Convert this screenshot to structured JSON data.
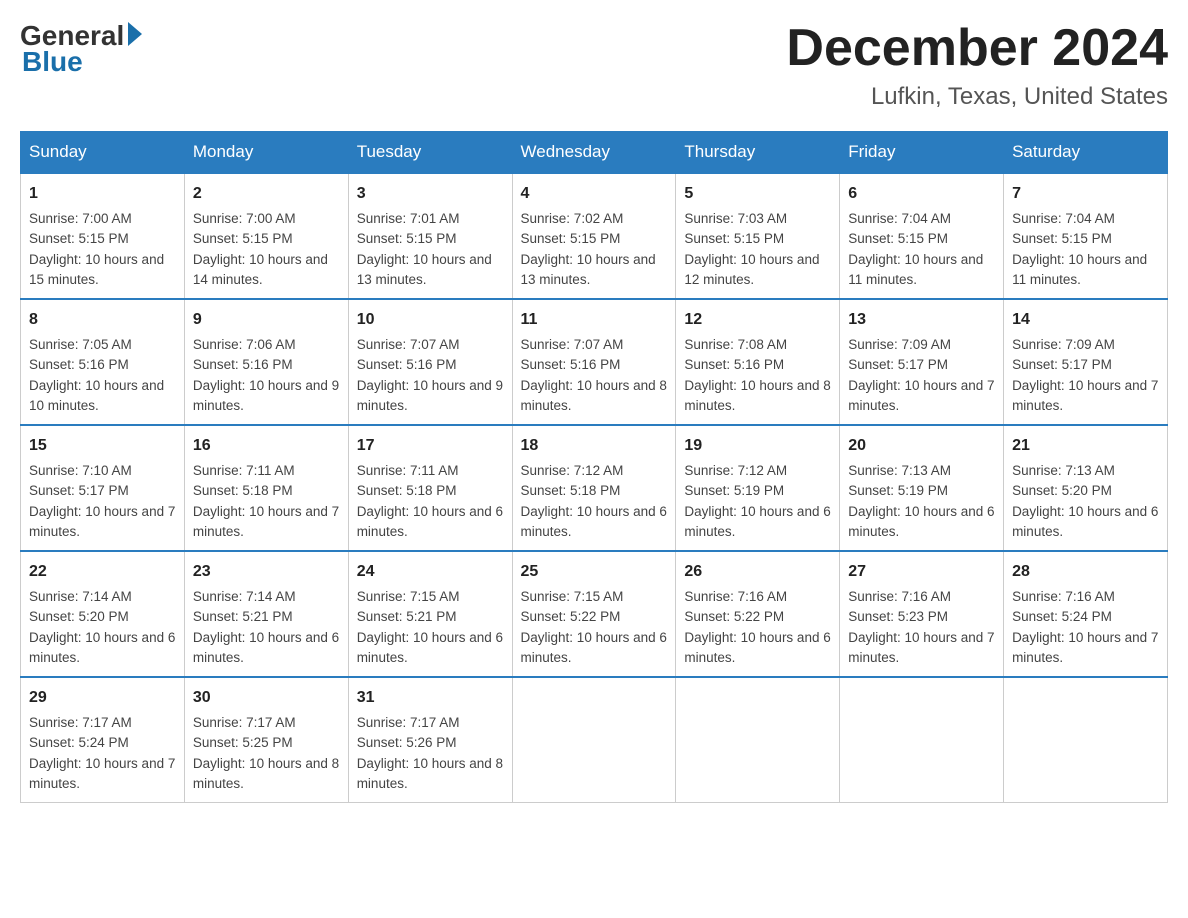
{
  "header": {
    "logo_general": "General",
    "logo_blue": "Blue",
    "month_title": "December 2024",
    "location": "Lufkin, Texas, United States"
  },
  "days_of_week": [
    "Sunday",
    "Monday",
    "Tuesday",
    "Wednesday",
    "Thursday",
    "Friday",
    "Saturday"
  ],
  "weeks": [
    [
      {
        "day": "1",
        "sunrise": "7:00 AM",
        "sunset": "5:15 PM",
        "daylight": "10 hours and 15 minutes."
      },
      {
        "day": "2",
        "sunrise": "7:00 AM",
        "sunset": "5:15 PM",
        "daylight": "10 hours and 14 minutes."
      },
      {
        "day": "3",
        "sunrise": "7:01 AM",
        "sunset": "5:15 PM",
        "daylight": "10 hours and 13 minutes."
      },
      {
        "day": "4",
        "sunrise": "7:02 AM",
        "sunset": "5:15 PM",
        "daylight": "10 hours and 13 minutes."
      },
      {
        "day": "5",
        "sunrise": "7:03 AM",
        "sunset": "5:15 PM",
        "daylight": "10 hours and 12 minutes."
      },
      {
        "day": "6",
        "sunrise": "7:04 AM",
        "sunset": "5:15 PM",
        "daylight": "10 hours and 11 minutes."
      },
      {
        "day": "7",
        "sunrise": "7:04 AM",
        "sunset": "5:15 PM",
        "daylight": "10 hours and 11 minutes."
      }
    ],
    [
      {
        "day": "8",
        "sunrise": "7:05 AM",
        "sunset": "5:16 PM",
        "daylight": "10 hours and 10 minutes."
      },
      {
        "day": "9",
        "sunrise": "7:06 AM",
        "sunset": "5:16 PM",
        "daylight": "10 hours and 9 minutes."
      },
      {
        "day": "10",
        "sunrise": "7:07 AM",
        "sunset": "5:16 PM",
        "daylight": "10 hours and 9 minutes."
      },
      {
        "day": "11",
        "sunrise": "7:07 AM",
        "sunset": "5:16 PM",
        "daylight": "10 hours and 8 minutes."
      },
      {
        "day": "12",
        "sunrise": "7:08 AM",
        "sunset": "5:16 PM",
        "daylight": "10 hours and 8 minutes."
      },
      {
        "day": "13",
        "sunrise": "7:09 AM",
        "sunset": "5:17 PM",
        "daylight": "10 hours and 7 minutes."
      },
      {
        "day": "14",
        "sunrise": "7:09 AM",
        "sunset": "5:17 PM",
        "daylight": "10 hours and 7 minutes."
      }
    ],
    [
      {
        "day": "15",
        "sunrise": "7:10 AM",
        "sunset": "5:17 PM",
        "daylight": "10 hours and 7 minutes."
      },
      {
        "day": "16",
        "sunrise": "7:11 AM",
        "sunset": "5:18 PM",
        "daylight": "10 hours and 7 minutes."
      },
      {
        "day": "17",
        "sunrise": "7:11 AM",
        "sunset": "5:18 PM",
        "daylight": "10 hours and 6 minutes."
      },
      {
        "day": "18",
        "sunrise": "7:12 AM",
        "sunset": "5:18 PM",
        "daylight": "10 hours and 6 minutes."
      },
      {
        "day": "19",
        "sunrise": "7:12 AM",
        "sunset": "5:19 PM",
        "daylight": "10 hours and 6 minutes."
      },
      {
        "day": "20",
        "sunrise": "7:13 AM",
        "sunset": "5:19 PM",
        "daylight": "10 hours and 6 minutes."
      },
      {
        "day": "21",
        "sunrise": "7:13 AM",
        "sunset": "5:20 PM",
        "daylight": "10 hours and 6 minutes."
      }
    ],
    [
      {
        "day": "22",
        "sunrise": "7:14 AM",
        "sunset": "5:20 PM",
        "daylight": "10 hours and 6 minutes."
      },
      {
        "day": "23",
        "sunrise": "7:14 AM",
        "sunset": "5:21 PM",
        "daylight": "10 hours and 6 minutes."
      },
      {
        "day": "24",
        "sunrise": "7:15 AM",
        "sunset": "5:21 PM",
        "daylight": "10 hours and 6 minutes."
      },
      {
        "day": "25",
        "sunrise": "7:15 AM",
        "sunset": "5:22 PM",
        "daylight": "10 hours and 6 minutes."
      },
      {
        "day": "26",
        "sunrise": "7:16 AM",
        "sunset": "5:22 PM",
        "daylight": "10 hours and 6 minutes."
      },
      {
        "day": "27",
        "sunrise": "7:16 AM",
        "sunset": "5:23 PM",
        "daylight": "10 hours and 7 minutes."
      },
      {
        "day": "28",
        "sunrise": "7:16 AM",
        "sunset": "5:24 PM",
        "daylight": "10 hours and 7 minutes."
      }
    ],
    [
      {
        "day": "29",
        "sunrise": "7:17 AM",
        "sunset": "5:24 PM",
        "daylight": "10 hours and 7 minutes."
      },
      {
        "day": "30",
        "sunrise": "7:17 AM",
        "sunset": "5:25 PM",
        "daylight": "10 hours and 8 minutes."
      },
      {
        "day": "31",
        "sunrise": "7:17 AM",
        "sunset": "5:26 PM",
        "daylight": "10 hours and 8 minutes."
      },
      null,
      null,
      null,
      null
    ]
  ]
}
